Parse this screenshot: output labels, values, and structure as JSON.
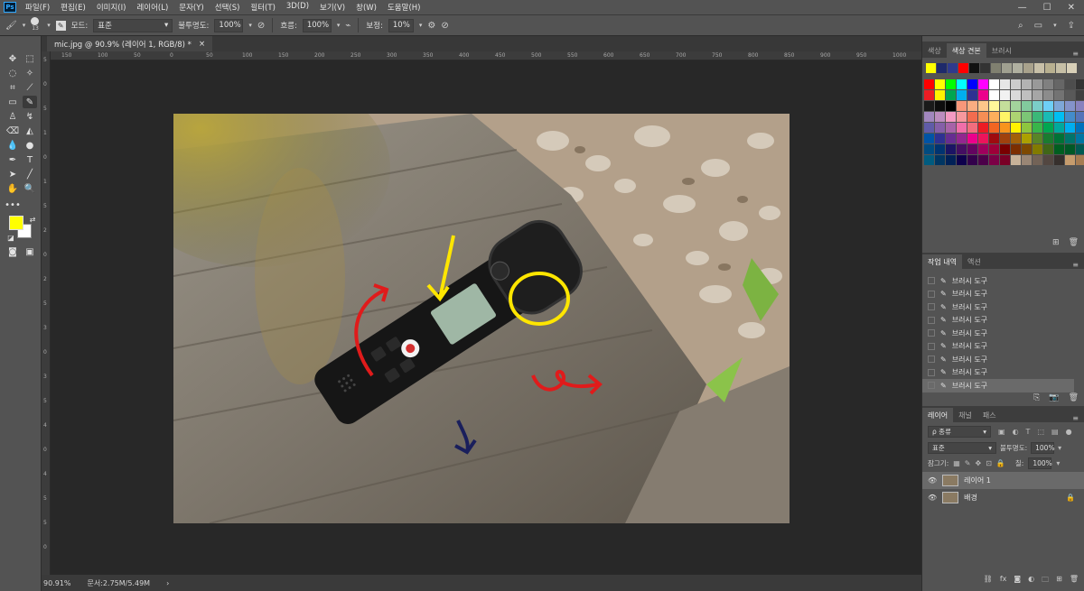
{
  "app": {
    "logo": "Ps"
  },
  "menu": [
    "파일(F)",
    "편집(E)",
    "이미지(I)",
    "레이어(L)",
    "문자(Y)",
    "선택(S)",
    "필터(T)",
    "3D(D)",
    "보기(V)",
    "창(W)",
    "도움말(H)"
  ],
  "options": {
    "brush_size": "13",
    "mode_label": "모드:",
    "mode_value": "표준",
    "opacity_label": "불투명도:",
    "opacity_value": "100%",
    "flow_label": "흐름:",
    "flow_value": "100%",
    "smoothing_label": "보정:",
    "smoothing_value": "10%"
  },
  "document": {
    "tab_title": "mic.jpg @ 90.9% (레이어 1, RGB/8) *",
    "close": "×",
    "ruler_top": [
      "150",
      "100",
      "50",
      "0",
      "50",
      "100",
      "150",
      "200",
      "250",
      "300",
      "350",
      "400",
      "450",
      "500",
      "550",
      "600",
      "650",
      "700",
      "750",
      "800",
      "850",
      "900",
      "950",
      "1000",
      "1050"
    ],
    "ruler_left": [
      "5",
      "0",
      "5",
      "1",
      "0",
      "1",
      "5",
      "2",
      "0",
      "2",
      "5",
      "3",
      "0",
      "3",
      "5",
      "4",
      "0",
      "4",
      "5",
      "5",
      "0"
    ]
  },
  "status": {
    "zoom": "90.91%",
    "doc_size": "문서:2.75M/5.49M",
    "arrow": "›"
  },
  "swatches_panel": {
    "tabs": [
      "색상",
      "색상 견본",
      "브러시"
    ],
    "active_tab": 1,
    "recent": [
      "#ffff00",
      "#1e2a6b",
      "#2f3a8c",
      "#ff0000",
      "#111111",
      "#333333",
      "#808070",
      "#a0a090",
      "#b0b0a0",
      "#a9a28c",
      "#c8c0a8",
      "#b8b090",
      "#c6bfa6",
      "#d8d0b8"
    ],
    "grid": [
      "#ff0000",
      "#ffff00",
      "#00ff00",
      "#00ffff",
      "#0000ff",
      "#ff00ff",
      "#ffffff",
      "#e6e6e6",
      "#cccccc",
      "#b3b3b3",
      "#999999",
      "#808080",
      "#666666",
      "#4d4d4d",
      "#333333",
      "#ed1c24",
      "#fff200",
      "#00a651",
      "#00aeef",
      "#2e3192",
      "#ec008c",
      "#ffffff",
      "#f2f2f2",
      "#d9d9d9",
      "#bfbfbf",
      "#a6a6a6",
      "#8c8c8c",
      "#737373",
      "#595959",
      "#404040",
      "#1a1a1a",
      "#0d0d0d",
      "#000000",
      "#f7977a",
      "#f9ad81",
      "#fdc68a",
      "#fff79a",
      "#c4df9b",
      "#a3d39c",
      "#82ca9d",
      "#7bcdc8",
      "#6ecff6",
      "#7ea7d8",
      "#8493ca",
      "#8882be",
      "#a187be",
      "#bc8dbf",
      "#f49ac2",
      "#f6989d",
      "#f26c4f",
      "#f68e55",
      "#fbaf5c",
      "#fff467",
      "#acd372",
      "#7cc576",
      "#3bb878",
      "#1abbb4",
      "#00bff3",
      "#438ccb",
      "#5574b9",
      "#605ca8",
      "#855fa8",
      "#a763a8",
      "#f06ea9",
      "#f26d7d",
      "#ed1c24",
      "#f26522",
      "#f7941d",
      "#fff200",
      "#8dc63f",
      "#39b54a",
      "#00a651",
      "#00a99d",
      "#00aeef",
      "#0072bc",
      "#0054a6",
      "#2e3192",
      "#662d91",
      "#92278f",
      "#ec008c",
      "#ed145b",
      "#9e0b0f",
      "#a0410d",
      "#a36209",
      "#aba000",
      "#598527",
      "#1a7b30",
      "#007236",
      "#00746b",
      "#0076a3",
      "#004b80",
      "#003471",
      "#1b1464",
      "#440e62",
      "#630460",
      "#9e005d",
      "#9e0039",
      "#790000",
      "#7b2e00",
      "#7d4900",
      "#827b00",
      "#406618",
      "#005e20",
      "#005826",
      "#005952",
      "#005b7f",
      "#003663",
      "#002157",
      "#0d004c",
      "#32004b",
      "#4b0049",
      "#7b0046",
      "#7a0026",
      "#c7b299",
      "#998675",
      "#736357",
      "#534741",
      "#37302d",
      "#c69c6d",
      "#a67c52"
    ]
  },
  "history_panel": {
    "tabs": [
      "작업 내역",
      "액션"
    ],
    "items": [
      "브러시 도구",
      "브러시 도구",
      "브러시 도구",
      "브러시 도구",
      "브러시 도구",
      "브러시 도구",
      "브러시 도구",
      "브러시 도구",
      "브러시 도구"
    ]
  },
  "layers_panel": {
    "tabs": [
      "레이어",
      "채널",
      "패스"
    ],
    "filter_label": "ρ 종류",
    "blend_mode": "표준",
    "opacity_label": "불투명도:",
    "opacity_value": "100%",
    "lock_label": "잠그기:",
    "fill_label": "칠:",
    "fill_value": "100%",
    "layers": [
      {
        "name": "레이어 1",
        "selected": true
      },
      {
        "name": "배경",
        "selected": false
      }
    ]
  }
}
